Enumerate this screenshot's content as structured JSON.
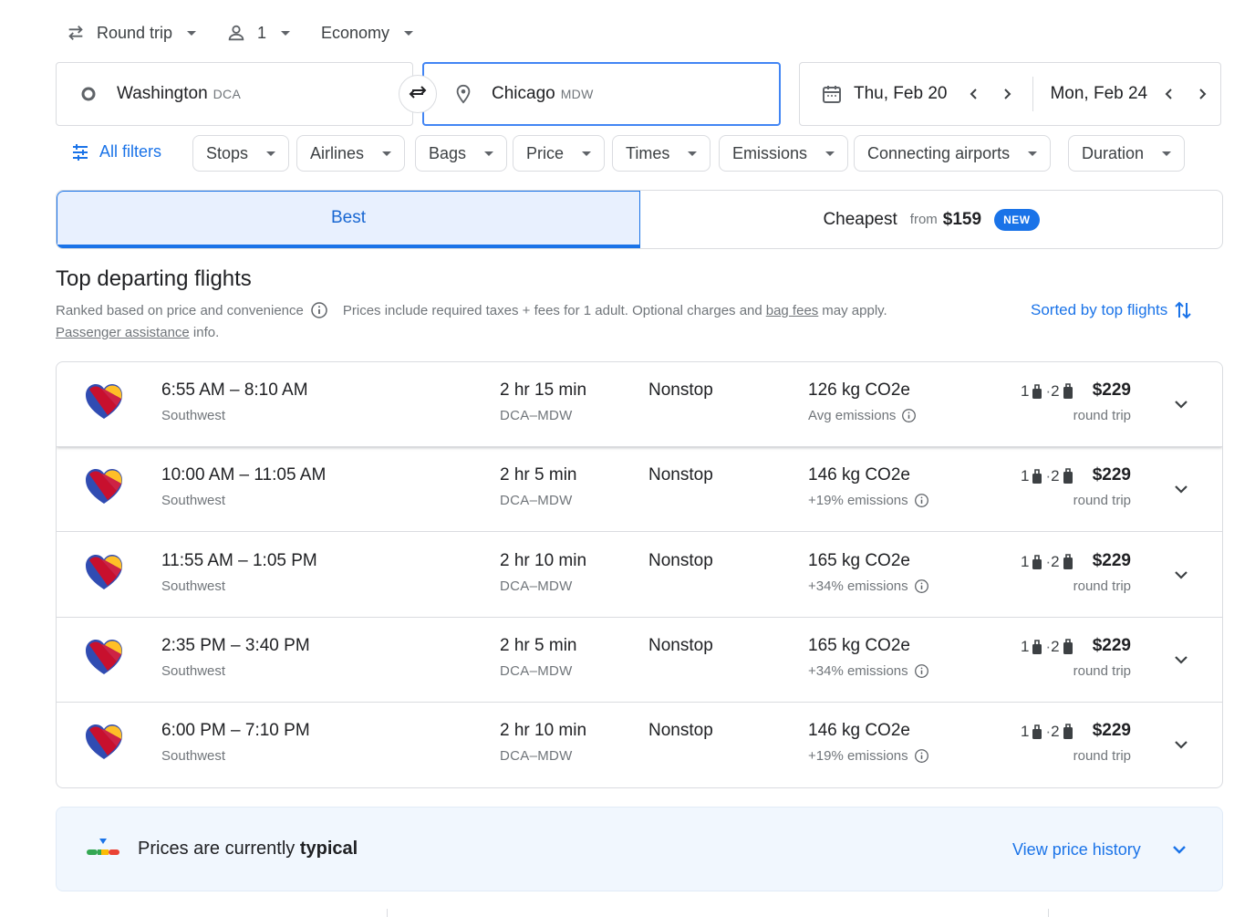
{
  "search": {
    "trip_type": "Round trip",
    "passengers": "1",
    "cabin": "Economy",
    "origin": {
      "city": "Washington",
      "code": "DCA"
    },
    "destination": {
      "city": "Chicago",
      "code": "MDW"
    },
    "depart_date": "Thu, Feb 20",
    "return_date": "Mon, Feb 24"
  },
  "filters": {
    "all_filters": "All filters",
    "chips": [
      "Stops",
      "Airlines",
      "Bags",
      "Price",
      "Times",
      "Emissions",
      "Connecting airports",
      "Duration"
    ]
  },
  "tabs": {
    "best": "Best",
    "cheapest": "Cheapest",
    "from": "from",
    "cheapest_price": "$159",
    "badge": "NEW"
  },
  "results": {
    "title": "Top departing flights",
    "ranked_text": "Ranked based on price and convenience",
    "prices_text": "Prices include required taxes + fees for 1 adult. Optional charges and",
    "bag_fees": "bag fees",
    "may_apply": "may apply.",
    "passenger_assistance": "Passenger assistance",
    "info": "info.",
    "sorted": "Sorted by top flights"
  },
  "flights": [
    {
      "times": "6:55 AM – 8:10 AM",
      "airline": "Southwest",
      "duration": "2 hr 15 min",
      "route": "DCA–MDW",
      "stops": "Nonstop",
      "co2": "126 kg CO2e",
      "emissions": "Avg emissions",
      "carry_on": "1",
      "checked": "2",
      "price": "$229",
      "trip": "round trip"
    },
    {
      "times": "10:00 AM – 11:05 AM",
      "airline": "Southwest",
      "duration": "2 hr 5 min",
      "route": "DCA–MDW",
      "stops": "Nonstop",
      "co2": "146 kg CO2e",
      "emissions": "+19% emissions",
      "carry_on": "1",
      "checked": "2",
      "price": "$229",
      "trip": "round trip"
    },
    {
      "times": "11:55 AM – 1:05 PM",
      "airline": "Southwest",
      "duration": "2 hr 10 min",
      "route": "DCA–MDW",
      "stops": "Nonstop",
      "co2": "165 kg CO2e",
      "emissions": "+34% emissions",
      "carry_on": "1",
      "checked": "2",
      "price": "$229",
      "trip": "round trip"
    },
    {
      "times": "2:35 PM – 3:40 PM",
      "airline": "Southwest",
      "duration": "2 hr 5 min",
      "route": "DCA–MDW",
      "stops": "Nonstop",
      "co2": "165 kg CO2e",
      "emissions": "+34% emissions",
      "carry_on": "1",
      "checked": "2",
      "price": "$229",
      "trip": "round trip"
    },
    {
      "times": "6:00 PM – 7:10 PM",
      "airline": "Southwest",
      "duration": "2 hr 10 min",
      "route": "DCA–MDW",
      "stops": "Nonstop",
      "co2": "146 kg CO2e",
      "emissions": "+19% emissions",
      "carry_on": "1",
      "checked": "2",
      "price": "$229",
      "trip": "round trip"
    }
  ],
  "price_insight": {
    "prefix": "Prices are currently",
    "level": "typical",
    "link": "View price history"
  },
  "colors": {
    "accent": "#1a73e8",
    "border": "#dadce0",
    "muted": "#70757a"
  },
  "icons": [
    "swap-arrows-icon",
    "person-icon",
    "origin-circle-icon",
    "location-pin-icon",
    "calendar-icon",
    "chevron-left-icon",
    "chevron-right-icon",
    "filter-sliders-icon",
    "info-icon",
    "sort-arrows-icon",
    "southwest-heart-logo",
    "carry-on-bag-icon",
    "checked-bag-icon",
    "chevron-down-icon",
    "price-bars-icon"
  ]
}
